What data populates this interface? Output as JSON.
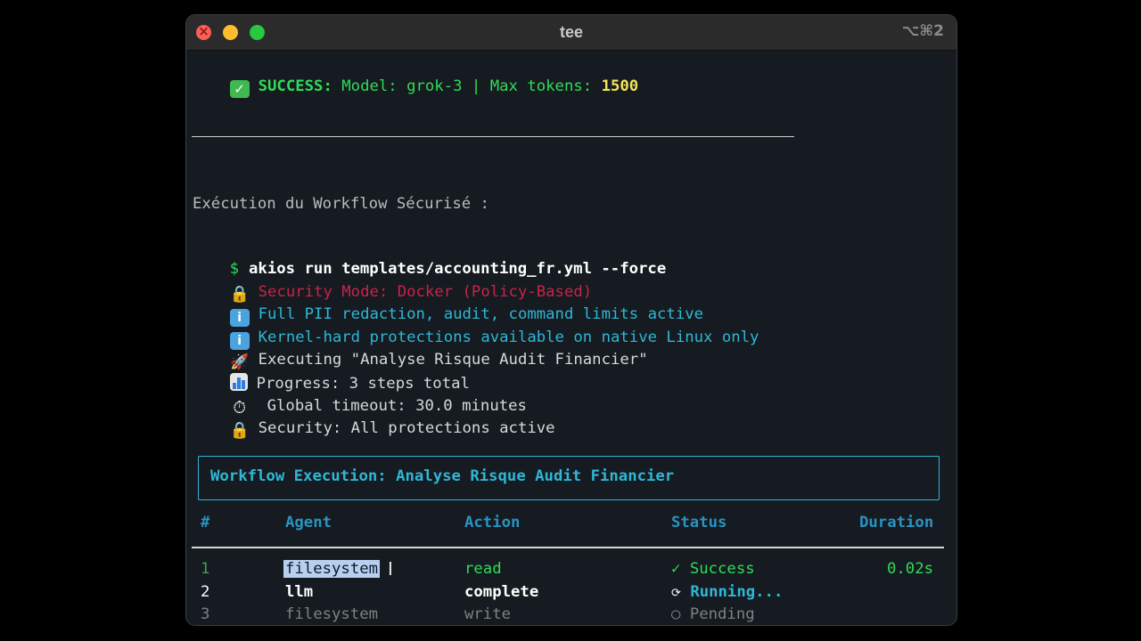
{
  "window": {
    "title": "tee",
    "shortcut": "⌥⌘2"
  },
  "terminal": {
    "success_line": {
      "label": "SUCCESS:",
      "model_text": " Model: grok-3 | Max tokens: ",
      "max_tokens": "1500"
    },
    "section_heading": "Exécution du Workflow Sécurisé :",
    "prompt_symbol": "$",
    "command": "akios run templates/accounting_fr.yml --force",
    "security_mode": "Security Mode: Docker (Policy-Based)",
    "info_pii": "Full PII redaction, audit, command limits active",
    "info_kernel": "Kernel-hard protections available on native Linux only",
    "executing": "Executing \"Analyse Risque Audit Financier\"",
    "progress": "Progress: 3 steps total",
    "timeout": "Global timeout: 30.0 minutes",
    "security": "Security: All protections active"
  },
  "panel": {
    "title": "Workflow Execution: Analyse Risque Audit Financier"
  },
  "table": {
    "headers": [
      "#",
      "Agent",
      "Action",
      "Status",
      "Duration"
    ],
    "rows": [
      {
        "num": "1",
        "agent": "filesystem",
        "action": "read",
        "status_icon": "✓",
        "status": "Success",
        "duration": "0.02s"
      },
      {
        "num": "2",
        "agent": "llm",
        "action": "complete",
        "status_icon": "⟳",
        "status": "Running...",
        "duration": ""
      },
      {
        "num": "3",
        "agent": "filesystem",
        "action": "write",
        "status_icon": "○",
        "status": "Pending",
        "duration": ""
      }
    ]
  },
  "icons": {
    "check": "check-emoji-icon",
    "lock": "lock-emoji-icon",
    "info": "info-emoji-icon",
    "rocket": "rocket-emoji-icon",
    "chart": "bar-chart-emoji-icon",
    "clock": "stopwatch-emoji-icon"
  },
  "colors": {
    "success_green": "#2fdc58",
    "accent_cyan": "#2eb7d6",
    "warning_red": "#c8234a",
    "max_tokens_yellow": "#f2e35a",
    "terminal_bg": "#151b20"
  }
}
